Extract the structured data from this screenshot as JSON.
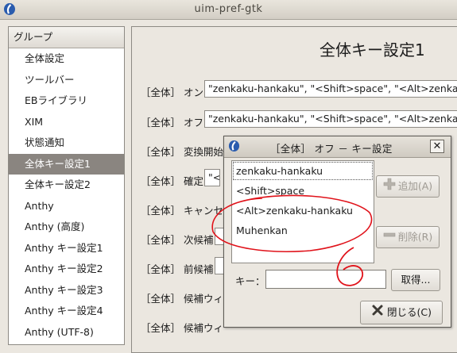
{
  "window": {
    "title": "uim-pref-gtk"
  },
  "sidebar": {
    "header": "グループ",
    "items": [
      {
        "label": "全体設定"
      },
      {
        "label": "ツールバー"
      },
      {
        "label": "EBライブラリ"
      },
      {
        "label": "XIM"
      },
      {
        "label": "状態通知"
      },
      {
        "label": "全体キー設定1",
        "selected": true
      },
      {
        "label": "全体キー設定2"
      },
      {
        "label": "Anthy"
      },
      {
        "label": "Anthy (高度)"
      },
      {
        "label": "Anthy キー設定1"
      },
      {
        "label": "Anthy キー設定2"
      },
      {
        "label": "Anthy キー設定3"
      },
      {
        "label": "Anthy キー設定4"
      },
      {
        "label": "Anthy (UTF-8)"
      }
    ]
  },
  "main": {
    "title": "全体キー設定1",
    "rows": [
      {
        "label": "［全体］ オン",
        "value": "\"zenkaku-hankaku\", \"<Shift>space\", \"<Alt>zenka"
      },
      {
        "label": "［全体］ オフ",
        "value": "\"zenkaku-hankaku\", \"<Shift>space\", \"<Alt>zenka"
      },
      {
        "label": "［全体］ 変換開始",
        "value": ""
      },
      {
        "label": "［全体］ 確定",
        "value": "\"<"
      },
      {
        "label": "［全体］ キャンセル",
        "value": ""
      },
      {
        "label": "［全体］ 次候補",
        "value": ""
      },
      {
        "label": "［全体］ 前候補",
        "value": ""
      },
      {
        "label": "［全体］ 候補ウィ",
        "value": ""
      },
      {
        "label": "［全体］ 候補ウィ",
        "value": ""
      }
    ]
  },
  "dialog": {
    "title": "［全体］ オフ － キー設定",
    "close_glyph": "✕",
    "keys": [
      "zenkaku-hankaku",
      "<Shift>space",
      "<Alt>zenkaku-hankaku",
      "Muhenkan"
    ],
    "add_label": "追加(A)",
    "remove_label": "削除(R)",
    "key_label": "キー：",
    "key_value": "",
    "capture_label": "取得...",
    "close_label": "閉じる(C)"
  },
  "annotation": {
    "text": "6",
    "color": "#e0121a"
  },
  "colors": {
    "selected_bg": "#8a8580",
    "window_bg": "#ebe7e0",
    "brand_blue": "#2a5cae"
  }
}
